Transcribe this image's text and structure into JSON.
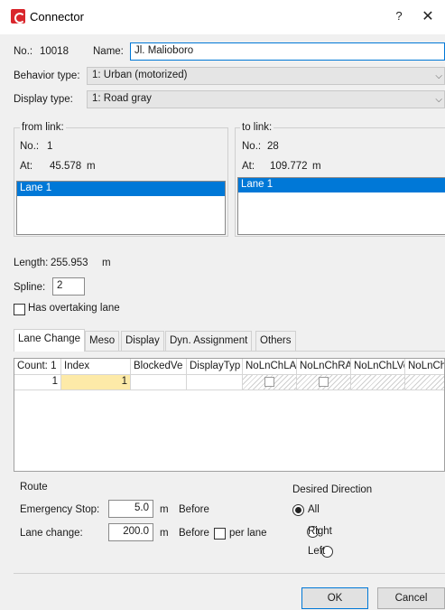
{
  "window": {
    "title": "Connector",
    "help": "?",
    "close": "✕"
  },
  "header": {
    "no_label": "No.:",
    "no_value": "10018",
    "name_label": "Name:",
    "name_value": "Jl. Malioboro",
    "behavior_label": "Behavior type:",
    "behavior_value": "1: Urban (motorized)",
    "display_label": "Display type:",
    "display_value": "1: Road gray"
  },
  "from_link": {
    "legend": "from link:",
    "no_label": "No.:",
    "no_value": "1",
    "at_label": "At:",
    "at_value": "45.578",
    "at_unit": "m",
    "lanes": [
      "Lane 1"
    ]
  },
  "to_link": {
    "legend": "to link:",
    "no_label": "No.:",
    "no_value": "28",
    "at_label": "At:",
    "at_value": "109.772",
    "at_unit": "m",
    "lanes": [
      "Lane 1"
    ]
  },
  "geometry": {
    "length_label": "Length:",
    "length_value": "255.953",
    "length_unit": "m",
    "spline_label": "Spline:",
    "spline_value": "2",
    "overtaking_label": "Has overtaking lane",
    "overtaking_checked": false
  },
  "tabs": [
    "Lane Change",
    "Meso",
    "Display",
    "Dyn. Assignment",
    "Others"
  ],
  "active_tab": "Lane Change",
  "table": {
    "count_header": "Count: 1",
    "columns": [
      "Index",
      "BlockedVe",
      "DisplayTyp",
      "NoLnChLA",
      "NoLnChRA",
      "NoLnChLVe",
      "NoLnChRV"
    ],
    "rows": [
      {
        "row_no": "1",
        "index": "1",
        "blocked": "",
        "display": ""
      }
    ]
  },
  "route": {
    "legend": "Route",
    "emergency_label": "Emergency Stop:",
    "emergency_value": "5.0",
    "emergency_unit": "m",
    "emergency_suffix": "Before",
    "lanechange_label": "Lane change:",
    "lanechange_value": "200.0",
    "lanechange_unit": "m",
    "lanechange_suffix": "Before",
    "per_lane_label": "per lane"
  },
  "direction": {
    "legend": "Desired Direction",
    "options": [
      "All",
      "Right",
      "Left"
    ],
    "selected": "All"
  },
  "buttons": {
    "ok": "OK",
    "cancel": "Cancel"
  }
}
